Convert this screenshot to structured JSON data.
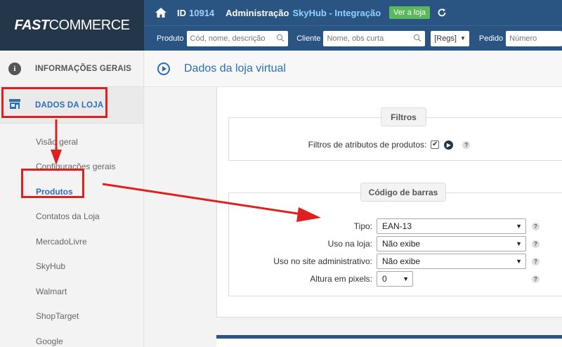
{
  "logo": {
    "part1": "FAST",
    "part2": "COMMERCE"
  },
  "topbar": {
    "id_label": "ID",
    "id_value": "10914",
    "admin_label": "Administração",
    "store_name": "SkyHub - Integração",
    "view_store_button": "Ver a loja"
  },
  "search": {
    "product_label": "Produto",
    "product_placeholder": "Cód, nome, descrição",
    "client_label": "Cliente",
    "client_placeholder": "Nome, obs curta",
    "regs_value": "[Regs]",
    "order_label": "Pedido",
    "order_placeholder": "Número"
  },
  "sidebar": {
    "info_label": "INFORMAÇÕES GERAIS",
    "store_label": "DADOS DA LOJA",
    "items": [
      {
        "label": "Visão geral",
        "active": false
      },
      {
        "label": "Configurações gerais",
        "active": false
      },
      {
        "label": "Produtos",
        "active": true
      },
      {
        "label": "Contatos da Loja",
        "active": false
      },
      {
        "label": "MercadoLivre",
        "active": false
      },
      {
        "label": "SkyHub",
        "active": false
      },
      {
        "label": "Walmart",
        "active": false
      },
      {
        "label": "ShopTarget",
        "active": false
      },
      {
        "label": "Google",
        "active": false
      }
    ]
  },
  "content": {
    "title": "Dados da loja virtual",
    "filters": {
      "legend": "Filtros",
      "attr_filter_label": "Filtros de atributos de produtos:",
      "attr_filter_checked": true
    },
    "barcode": {
      "legend": "Código de barras",
      "type_label": "Tipo:",
      "type_value": "EAN-13",
      "store_use_label": "Uso na loja:",
      "store_use_value": "Não exibe",
      "admin_use_label": "Uso no site administrativo:",
      "admin_use_value": "Não exibe",
      "height_label": "Altura em pixels:",
      "height_value": "0"
    },
    "help_glyph": "?",
    "check_glyph": "✔"
  },
  "colors": {
    "header_dark": "#23364a",
    "header_blue": "#2a5582",
    "accent_blue": "#2b6fb6",
    "green": "#5cb85c",
    "annotation_red": "#e02020"
  }
}
